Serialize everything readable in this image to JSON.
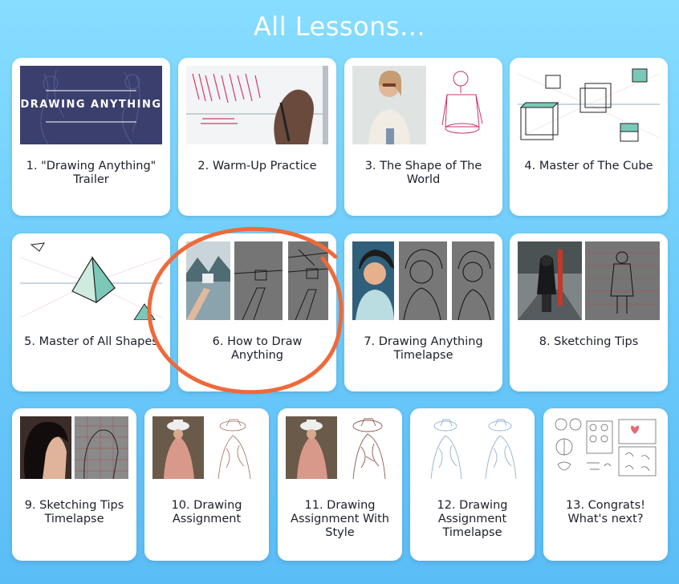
{
  "page": {
    "title": "All Lessons..."
  },
  "colors": {
    "background": "#6fcdfb",
    "card": "#ffffff",
    "text": "#1c1f2a",
    "highlight_circle": "#ee6a3a",
    "trailer_bg": "#3a3f6e"
  },
  "lessons": [
    {
      "label": "1. \"Drawing Anything\" Trailer",
      "thumb_text": "DRAWING ANYTHING",
      "thumb": "trailer-banner"
    },
    {
      "label": "2. Warm-Up Practice",
      "thumb": "hand-drawing-lines"
    },
    {
      "label": "3. The Shape of The World",
      "thumb": "photo-and-torso-sketch"
    },
    {
      "label": "4. Master of The Cube",
      "thumb": "perspective-cubes"
    },
    {
      "label": "5. Master of All Shapes",
      "thumb": "perspective-pyramids"
    },
    {
      "label": "6. How to Draw Anything",
      "thumb": "photo-to-sketch-triptych",
      "highlighted": true
    },
    {
      "label": "7. Drawing Anything Timelapse",
      "thumb": "woman-portrait-sketches"
    },
    {
      "label": "8. Sketching Tips",
      "thumb": "figure-photo-and-sketch"
    },
    {
      "label": "9. Sketching Tips Timelapse",
      "thumb": "profile-photo-and-sketch"
    },
    {
      "label": "10. Drawing Assignment",
      "thumb": "hat-woman-photo-and-sketch"
    },
    {
      "label": "11. Drawing Assignment With Style",
      "thumb": "hat-woman-styled-sketch"
    },
    {
      "label": "12. Drawing Assignment Timelapse",
      "thumb": "blue-pencil-sketches"
    },
    {
      "label": "13. Congrats! What's next?",
      "thumb": "sketch-collection"
    }
  ]
}
